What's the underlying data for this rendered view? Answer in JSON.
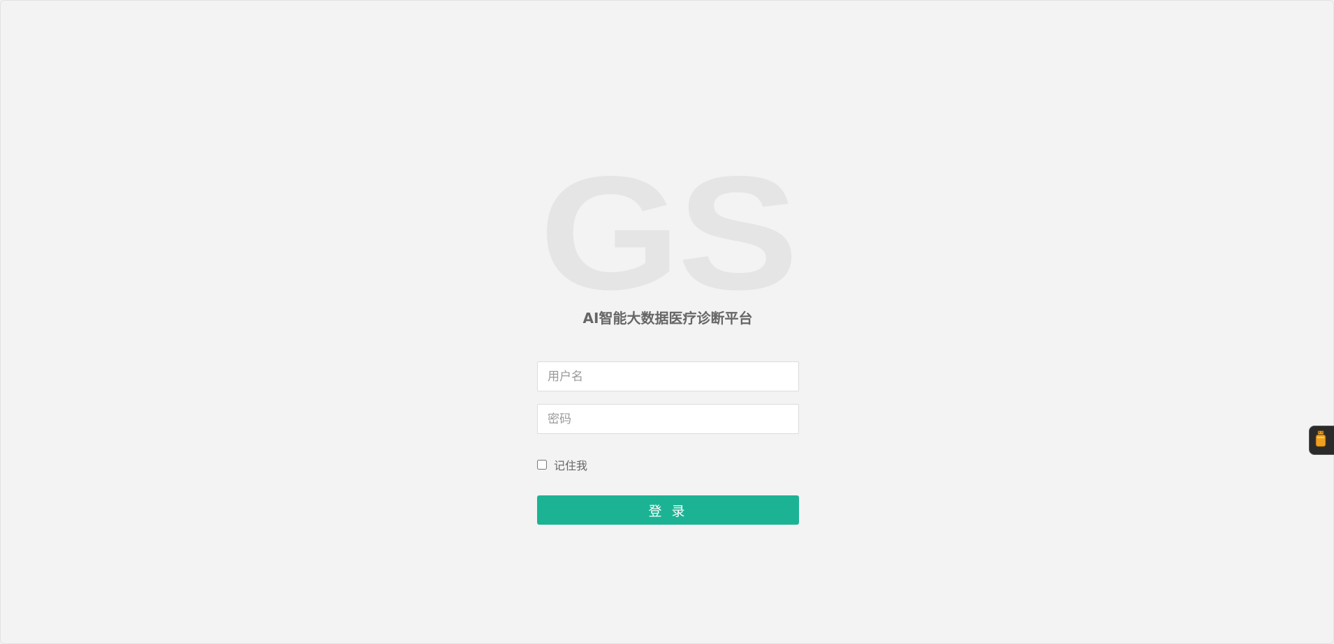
{
  "logo": {
    "text": "GS"
  },
  "title": "AI智能大数据医疗诊断平台",
  "form": {
    "username_placeholder": "用户名",
    "password_placeholder": "密码",
    "remember_label": "记住我",
    "login_label": "登 录"
  },
  "side_widget": {
    "icon": "bottle-icon",
    "color": "#f0a020"
  },
  "colors": {
    "background": "#f3f3f3",
    "primary": "#1bb394",
    "logo": "#e5e5e5"
  }
}
